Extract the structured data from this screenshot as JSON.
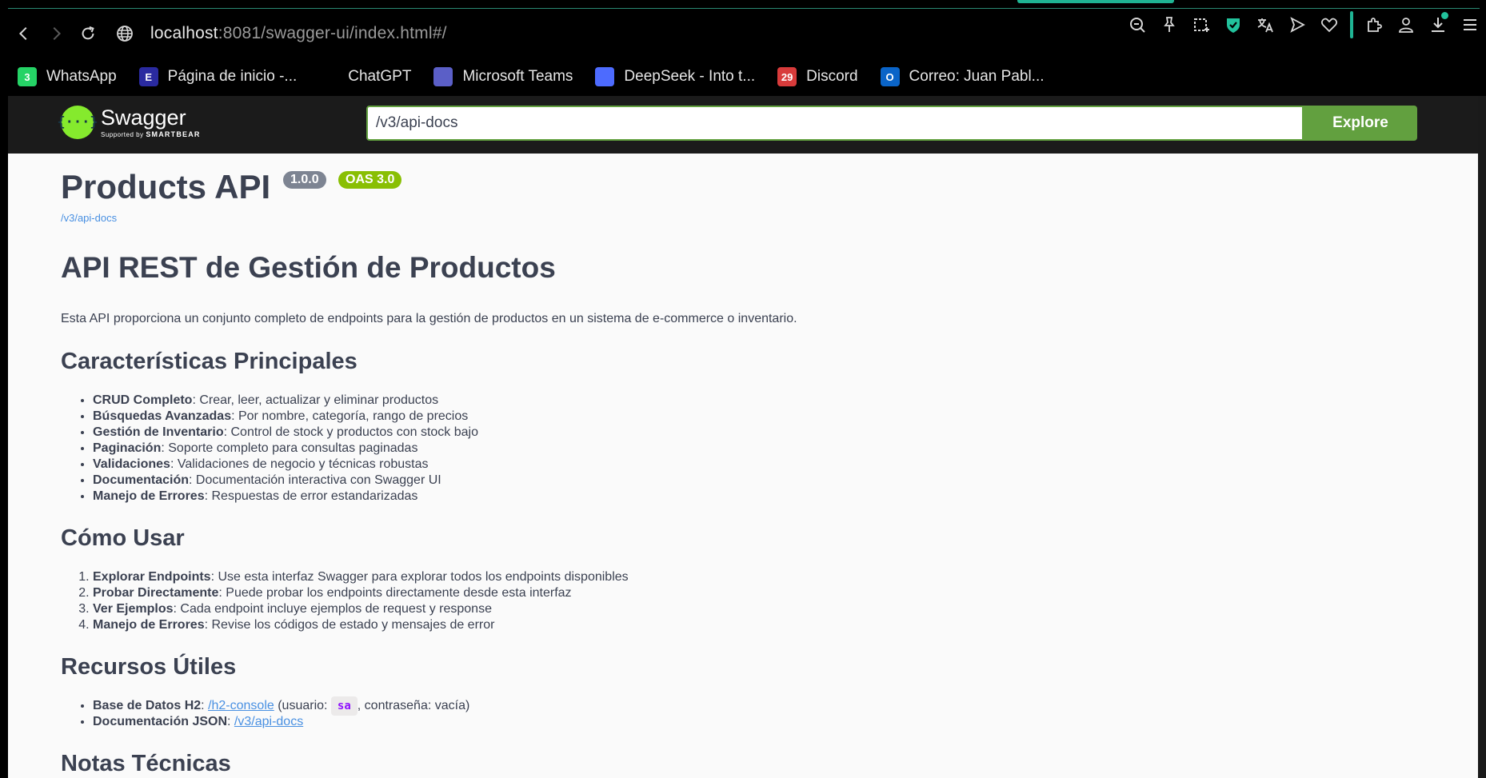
{
  "browser": {
    "url_host": "localhost",
    "url_rest": ":8081/swagger-ui/index.html#/",
    "bookmarks": [
      {
        "label": "WhatsApp",
        "icon": "whatsapp-icon",
        "badge": "3",
        "color": "#25d366"
      },
      {
        "label": "Página de inicio -...",
        "icon": "e-icon",
        "badge": "E",
        "color": "#2a2aa0"
      },
      {
        "label": "ChatGPT",
        "icon": "chatgpt-icon",
        "badge": "",
        "color": "#000000"
      },
      {
        "label": "Microsoft Teams",
        "icon": "teams-icon",
        "badge": "",
        "color": "#5b5fc7"
      },
      {
        "label": "DeepSeek - Into t...",
        "icon": "deepseek-icon",
        "badge": "",
        "color": "#4d6bfe"
      },
      {
        "label": "Discord",
        "icon": "calendar-icon",
        "badge": "29",
        "color": "#d83b3b"
      },
      {
        "label": "Correo: Juan Pabl...",
        "icon": "outlook-icon",
        "badge": "O",
        "color": "#0a64c8"
      }
    ]
  },
  "swagger": {
    "logo_name": "Swagger",
    "logo_sub_prefix": "Supported by",
    "logo_sub_brand": "SMARTBEAR",
    "search_value": "/v3/api-docs",
    "explore_label": "Explore",
    "accent": "#62a03f"
  },
  "info": {
    "title": "Products API",
    "version": "1.0.0",
    "oas": "OAS 3.0",
    "url": "/v3/api-docs",
    "heading": "API REST de Gestión de Productos",
    "description": "Esta API proporciona un conjunto completo de endpoints para la gestión de productos en un sistema de e-commerce o inventario.",
    "features_title": "Características Principales",
    "features": [
      {
        "b": "CRUD Completo",
        "t": ": Crear, leer, actualizar y eliminar productos"
      },
      {
        "b": "Búsquedas Avanzadas",
        "t": ": Por nombre, categoría, rango de precios"
      },
      {
        "b": "Gestión de Inventario",
        "t": ": Control de stock y productos con stock bajo"
      },
      {
        "b": "Paginación",
        "t": ": Soporte completo para consultas paginadas"
      },
      {
        "b": "Validaciones",
        "t": ": Validaciones de negocio y técnicas robustas"
      },
      {
        "b": "Documentación",
        "t": ": Documentación interactiva con Swagger UI"
      },
      {
        "b": "Manejo de Errores",
        "t": ": Respuestas de error estandarizadas"
      }
    ],
    "usage_title": "Cómo Usar",
    "usage": [
      {
        "b": "Explorar Endpoints",
        "t": ": Use esta interfaz Swagger para explorar todos los endpoints disponibles"
      },
      {
        "b": "Probar Directamente",
        "t": ": Puede probar los endpoints directamente desde esta interfaz"
      },
      {
        "b": "Ver Ejemplos",
        "t": ": Cada endpoint incluye ejemplos de request y response"
      },
      {
        "b": "Manejo de Errores",
        "t": ": Revise los códigos de estado y mensajes de error"
      }
    ],
    "resources_title": "Recursos Útiles",
    "resources": {
      "db_label": "Base de Datos H2",
      "db_link": "/h2-console",
      "db_pre": " (usuario: ",
      "db_user": "sa",
      "db_post": ", contraseña: vacía)",
      "json_label": "Documentación JSON",
      "json_link": "/v3/api-docs"
    },
    "notes_title": "Notas Técnicas"
  }
}
